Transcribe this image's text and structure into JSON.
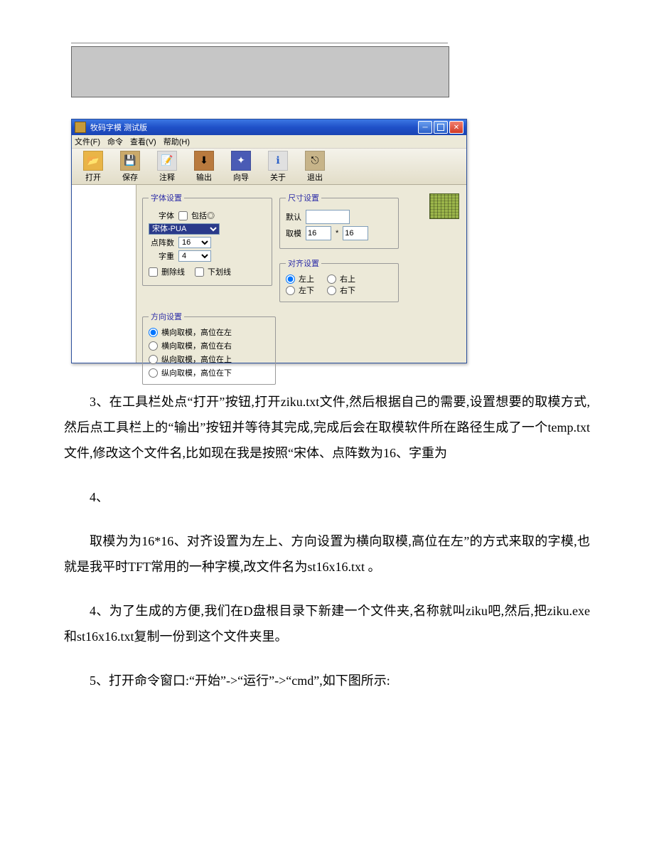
{
  "app": {
    "title": "牧码字模  测试版",
    "menu": {
      "file": "文件(F)",
      "cmd": "命令",
      "view": "查看(V)",
      "help": "帮助(H)"
    },
    "toolbar": {
      "open": "打开",
      "save": "保存",
      "note": "注释",
      "export": "输出",
      "wizard": "向导",
      "about": "关于",
      "exit": "退出"
    },
    "font_group": {
      "legend": "字体设置",
      "font_label": "字体",
      "include_label": "包括◎",
      "font_value": "宋体-PUA",
      "dot_label": "点阵数",
      "dot_value": "16",
      "weight_label": "字重",
      "weight_value": "4",
      "strike_label": "删除线",
      "underline_label": "下划线"
    },
    "size_group": {
      "legend": "尺寸设置",
      "default_label": "默认",
      "default_value": "",
      "take_label": "取模",
      "w": "16",
      "h": "16",
      "mul": "*"
    },
    "align_group": {
      "legend": "对齐设置",
      "tl": "左上",
      "tr": "右上",
      "bl": "左下",
      "br": "右下"
    },
    "dir_group": {
      "legend": "方向设置",
      "o1": "横向取模，高位在左",
      "o2": "横向取模，高位在右",
      "o3": "纵向取模，高位在上",
      "o4": "纵向取模，高位在下"
    }
  },
  "doc": {
    "p1": "3、在工具栏处点“打开”按钮,打开ziku.txt文件,然后根据自己的需要,设置想要的取模方式,然后点工具栏上的“输出”按钮并等待其完成,完成后会在取模软件所在路径生成了一个temp.txt文件,修改这个文件名,比如现在我是按照“宋体、点阵数为16、字重为",
    "p2": "4、",
    "p3": "取模为为16*16、对齐设置为左上、方向设置为横向取模,高位在左”的方式来取的字模,也就是我平时TFT常用的一种字模,改文件名为st16x16.txt 。",
    "p4": "4、为了生成的方便,我们在D盘根目录下新建一个文件夹,名称就叫ziku吧,然后,把ziku.exe 和st16x16.txt复制一份到这个文件夹里。",
    "p5": "5、打开命令窗口:“开始”->“运行”->“cmd”,如下图所示:"
  }
}
